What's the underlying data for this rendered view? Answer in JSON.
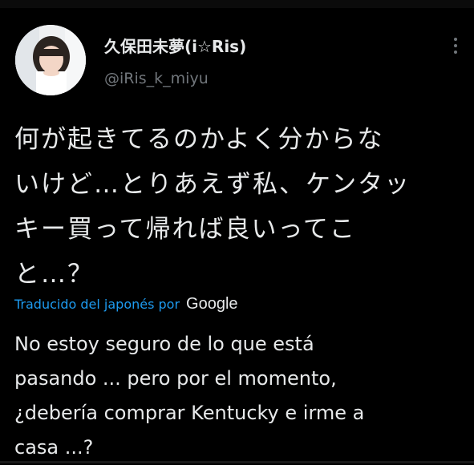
{
  "tweet": {
    "author": {
      "display_name": "久保田未夢(i☆Ris)",
      "handle": "@iRis_k_miyu"
    },
    "text_lines": [
      "何が起きてるのかよく分からな",
      "いけど…とりあえず私、ケンタッ",
      "キー買って帰れば良いってこ",
      "と…？"
    ],
    "translation": {
      "label": "Traducido del japonés por",
      "provider": "Google",
      "text_lines": [
        "No estoy seguro de lo que está",
        "pasando ... pero por el momento,",
        "¿debería comprar Kentucky e irme a",
        "casa ...?"
      ]
    },
    "icons": {
      "more": "more-horizontal-icon"
    }
  },
  "colors": {
    "background": "#000000",
    "text_primary": "#e7e9ea",
    "text_secondary": "#71767b",
    "link": "#1d9bf0"
  }
}
